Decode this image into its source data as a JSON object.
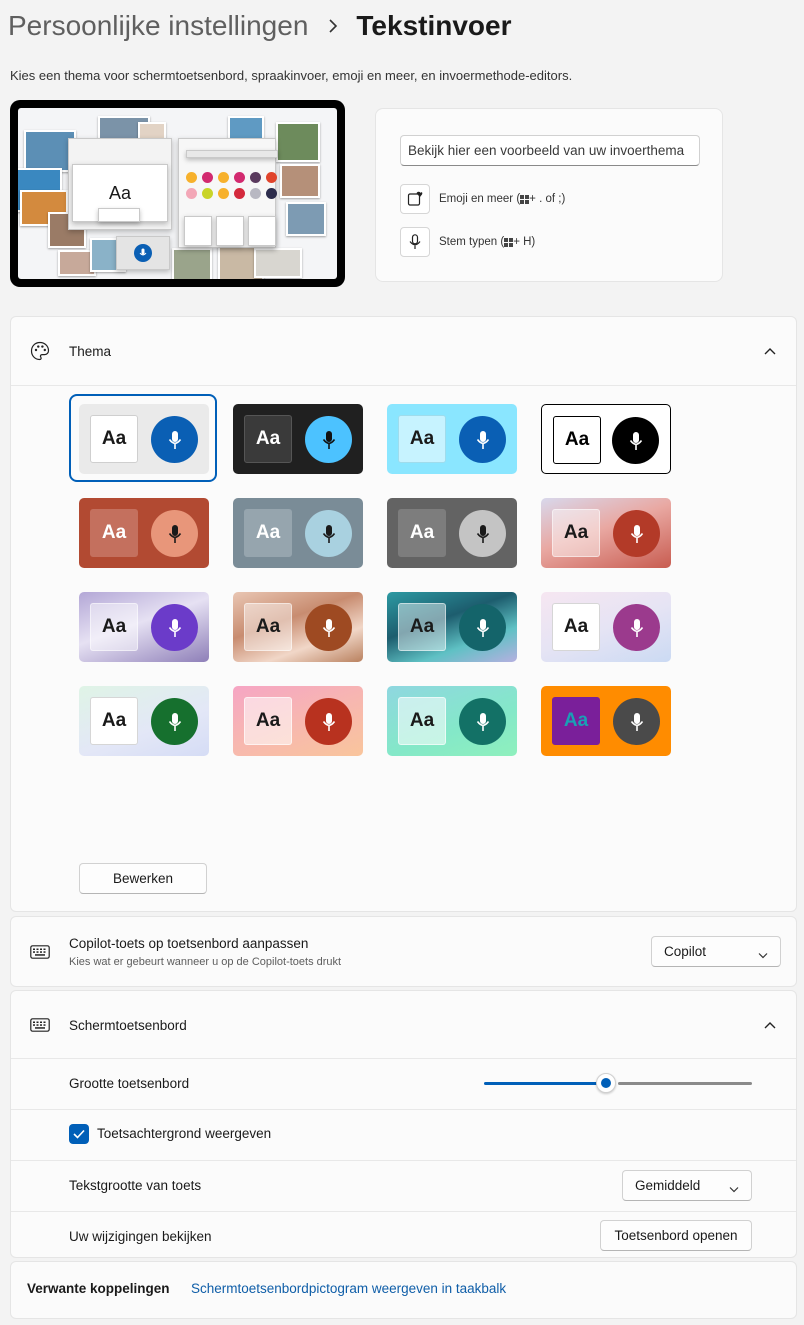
{
  "breadcrumb": {
    "parent": "Persoonlijke instellingen",
    "current": "Tekstinvoer"
  },
  "subtitle": "Kies een thema voor schermtoetsenbord, spraakinvoer, emoji en meer, en invoermethode-editors.",
  "preview": {
    "keyboard_sample": "Aa",
    "input_placeholder": "Bekijk hier een voorbeeld van uw invoerthema",
    "emoji_label": "Emoji en meer (",
    "emoji_shortcut": " + . of ;)",
    "voice_label": "Stem typen (",
    "voice_shortcut": " + H)"
  },
  "theme_section": {
    "title": "Thema",
    "selected_index": 0,
    "edit_button": "Bewerken",
    "themes": [
      {
        "bg": "#eaeaea",
        "aa_bg": "#ffffff",
        "aa_color": "#1a1a1a",
        "aa_border": "#cfcfcf",
        "mic_bg": "#0a5fb4",
        "mic_color": "#ffffff",
        "label": "Aa"
      },
      {
        "bg": "#202020",
        "aa_bg": "#3a3a3a",
        "aa_color": "#ffffff",
        "aa_border": "#555555",
        "mic_bg": "#4cc2ff",
        "mic_color": "#111111",
        "label": "Aa"
      },
      {
        "bg": "#8ae6ff",
        "aa_bg": "#c7f3ff",
        "aa_color": "#1a1a1a",
        "aa_border": "#9fdcec",
        "mic_bg": "#0a5fb4",
        "mic_color": "#ffffff",
        "label": "Aa"
      },
      {
        "bg": "#ffffff",
        "aa_bg": "#ffffff",
        "aa_color": "#000000",
        "aa_border": "#000000",
        "mic_bg": "#000000",
        "mic_color": "#ffffff",
        "label": "Aa",
        "outline": "#000000"
      },
      {
        "bg": "#b24a32",
        "aa_bg": "#c4705e",
        "aa_color": "#ffffff",
        "aa_border": "#c4705e",
        "mic_bg": "#e8967a",
        "mic_color": "#1a1a1a",
        "label": "Aa"
      },
      {
        "bg": "#7a8c97",
        "aa_bg": "#96a5ae",
        "aa_color": "#ffffff",
        "aa_border": "#96a5ae",
        "mic_bg": "#a9d1e0",
        "mic_color": "#1a1a1a",
        "label": "Aa"
      },
      {
        "bg": "#636363",
        "aa_bg": "#7d7d7d",
        "aa_color": "#ffffff",
        "aa_border": "#7d7d7d",
        "mic_bg": "#c4c4c4",
        "mic_color": "#1a1a1a",
        "label": "Aa"
      },
      {
        "bg": "linear-gradient(160deg,#d8d8ec 0%,#e9a8a2 45%,#c85c50 100%)",
        "aa_bg": "rgba(255,255,255,0.45)",
        "aa_color": "#1a1a1a",
        "aa_border": "rgba(255,255,255,0.5)",
        "mic_bg": "#b33a28",
        "mic_color": "#ffffff",
        "label": "Aa"
      },
      {
        "bg": "linear-gradient(160deg,#b3a7d6 0%,#e6e1f3 45%,#8e7fb8 100%)",
        "aa_bg": "rgba(255,255,255,0.45)",
        "aa_color": "#1a1a1a",
        "aa_border": "rgba(255,255,255,0.5)",
        "mic_bg": "#6b3bc9",
        "mic_color": "#ffffff",
        "label": "Aa"
      },
      {
        "bg": "linear-gradient(160deg,#e9c6b3 0%,#c88c70 40%,#f1d7c8 70%,#b9815f 100%)",
        "aa_bg": "rgba(255,255,255,0.45)",
        "aa_color": "#1a1a1a",
        "aa_border": "rgba(255,255,255,0.5)",
        "mic_bg": "#9e4a22",
        "mic_color": "#ffffff",
        "label": "Aa"
      },
      {
        "bg": "linear-gradient(160deg,#2d9aa3 0%,#1d5d6e 40%,#5fc1c4 70%,#b6b0e0 100%)",
        "aa_bg": "rgba(255,255,255,0.45)",
        "aa_color": "#1a1a1a",
        "aa_border": "rgba(255,255,255,0.5)",
        "mic_bg": "#14646a",
        "mic_color": "#ffffff",
        "label": "Aa"
      },
      {
        "bg": "linear-gradient(160deg,#f6e6f1 0%,#e6e4f4 50%,#cbdaf3 100%)",
        "aa_bg": "#ffffff",
        "aa_color": "#1a1a1a",
        "aa_border": "#d6d6d6",
        "mic_bg": "#9b3a8d",
        "mic_color": "#ffffff",
        "label": "Aa"
      },
      {
        "bg": "linear-gradient(160deg,#dff4e6 0%,#e3e7f7 60%,#d5dcf5 100%)",
        "aa_bg": "#ffffff",
        "aa_color": "#1a1a1a",
        "aa_border": "#d6d6d6",
        "mic_bg": "#16702e",
        "mic_color": "#ffffff",
        "label": "Aa"
      },
      {
        "bg": "linear-gradient(160deg,#f6a5c4 0%,#f7b7b0 50%,#f9c59c 100%)",
        "aa_bg": "rgba(255,255,255,0.55)",
        "aa_color": "#1a1a1a",
        "aa_border": "rgba(255,255,255,0.6)",
        "mic_bg": "#b8321f",
        "mic_color": "#ffffff",
        "label": "Aa"
      },
      {
        "bg": "linear-gradient(160deg,#8fd7e0 0%,#84e8c8 60%,#8ff0bd 100%)",
        "aa_bg": "rgba(255,255,255,0.55)",
        "aa_color": "#1a1a1a",
        "aa_border": "rgba(255,255,255,0.6)",
        "mic_bg": "#137166",
        "mic_color": "#ffffff",
        "label": "Aa"
      },
      {
        "bg": "#ff8c00",
        "aa_bg": "#7a1f9a",
        "aa_color": "#1a9fb5",
        "aa_border": "#7a1f9a",
        "mic_bg": "#4a4a4a",
        "mic_color": "#ffffff",
        "label": "Aa"
      }
    ]
  },
  "copilot": {
    "title": "Copilot-toets op toetsenbord aanpassen",
    "description": "Kies wat er gebeurt wanneer u op de Copilot-toets drukt",
    "value": "Copilot"
  },
  "touch_keyboard": {
    "title": "Schermtoetsenbord",
    "size_label": "Grootte toetsenbord",
    "size_value": 0.45,
    "key_background_label": "Toetsachtergrond weergeven",
    "key_background_checked": true,
    "text_size_label": "Tekstgrootte van toets",
    "text_size_value": "Gemiddeld",
    "review_label": "Uw wijzigingen bekijken",
    "open_button": "Toetsenbord openen"
  },
  "related": {
    "label": "Verwante koppelingen",
    "link": "Schermtoetsenbordpictogram weergeven in taakbalk"
  },
  "colors": {
    "accent": "#005fb8",
    "link": "#0f5ea8"
  }
}
